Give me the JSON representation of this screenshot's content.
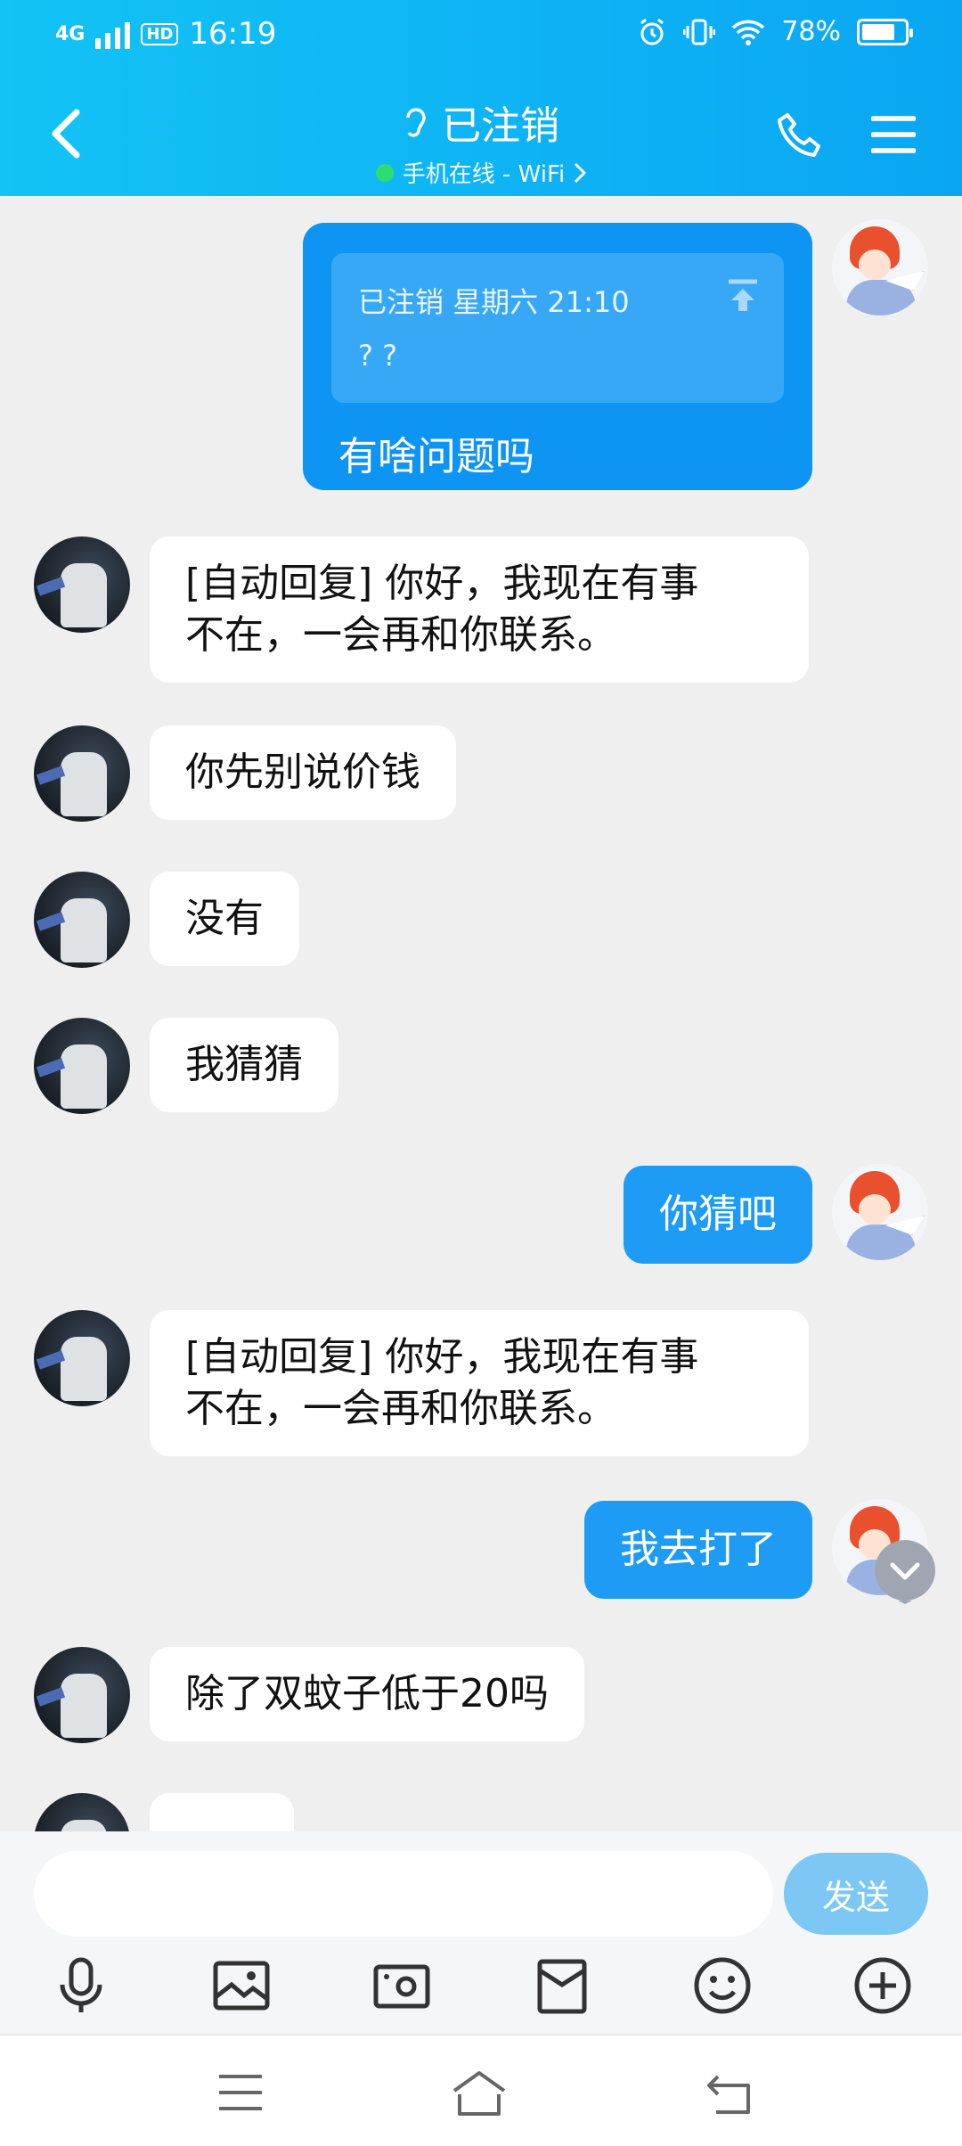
{
  "status_bar": {
    "network": "4G",
    "hd": "HD",
    "time": "16:19",
    "battery_text": "78%",
    "battery_level": 0.78
  },
  "header": {
    "title": "已注销",
    "subtitle": "手机在线 - WiFi"
  },
  "messages": [
    {
      "from": "me",
      "quote_header": "已注销 星期六 21:10",
      "quote_text": "? ?",
      "text": "有啥问题吗"
    },
    {
      "from": "other",
      "text_line1": "[自动回复] 你好，我现在有事",
      "text_line2": "不在，一会再和你联系。"
    },
    {
      "from": "other",
      "text": "你先别说价钱"
    },
    {
      "from": "other",
      "text": "没有"
    },
    {
      "from": "other",
      "text": "我猜猜"
    },
    {
      "from": "me",
      "text": "你猜吧"
    },
    {
      "from": "other",
      "text_line1": "[自动回复] 你好，我现在有事",
      "text_line2": "不在，一会再和你联系。"
    },
    {
      "from": "me",
      "text": "我去打了"
    },
    {
      "from": "other",
      "text": "除了双蚊子低于20吗"
    }
  ],
  "input": {
    "placeholder": "",
    "send_label": "发送"
  },
  "toolbar_icons": [
    "microphone-icon",
    "image-icon",
    "camera-icon",
    "red-envelope-icon",
    "emoji-icon",
    "plus-icon"
  ],
  "colors": {
    "header_start": "#13c3f5",
    "header_end": "#0aa6f3",
    "bubble_out": "#1d9bf5",
    "bubble_in": "#ffffff",
    "send_button": "#7cc7f4"
  }
}
